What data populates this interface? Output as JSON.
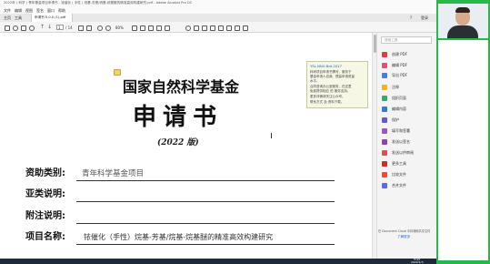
{
  "window": {
    "title": "2022年 ( 科学 ) 青年基金项目申请书 - 铱催化 ( 手性 ) 烷基-芳基/烷基-烷基醚的精准高效构建研究.pdf - Adobe Acrobat Pro DC",
    "menu": [
      "文件",
      "编辑",
      "视图",
      "签名",
      "窗口",
      "帮助"
    ],
    "tab_left": "主页",
    "tab_right": "工具",
    "doc_tab": "申请书 5.0.0 (1).pdf",
    "right_actions": [
      "?",
      "登录"
    ]
  },
  "toolbar": {
    "page_current": "1",
    "page_total": "/ 14",
    "zoom": "80%"
  },
  "document": {
    "title_main": "国家自然科学基金",
    "title_doc": "申 请 书",
    "year": "(2022 版)",
    "fields": [
      {
        "label": "资助类别:",
        "value": "青年科学基金项目"
      },
      {
        "label": "亚类说明:",
        "value": ""
      },
      {
        "label": "附注说明:",
        "value": ""
      },
      {
        "label": "项目名称:",
        "value": "铱催化（手性）烷基-芳基/烷基-烷基醚的精准高效构建研究"
      }
    ]
  },
  "popup": {
    "header": "YSL.NNU.Bot.2017",
    "lines": [
      "科研项目申请书撰写，服务于",
      "基金申请人自我、提高申请质量",
      "水平。",
      "合同咨询办公室服务，在这里",
      "免费提供相应 的 服务支持。",
      "更多详情请关注公众号。",
      "联系方式 及 资料下载。"
    ]
  },
  "right_panel": {
    "search_placeholder": "搜索工具",
    "items": [
      {
        "label": "创建 PDF",
        "icon": "create-pdf-icon",
        "color": "#d64141"
      },
      {
        "label": "编辑 PDF",
        "icon": "edit-pdf-icon",
        "color": "#e0527a"
      },
      {
        "label": "导出 PDF",
        "icon": "export-pdf-icon",
        "color": "#4a7fd4"
      },
      {
        "label": "注释",
        "icon": "comment-icon",
        "color": "#f0b429"
      },
      {
        "label": "组织页面",
        "icon": "organize-pages-icon",
        "color": "#3aa66a"
      },
      {
        "label": "编辑内容",
        "icon": "edit-content-icon",
        "color": "#2f80c8"
      },
      {
        "label": "保护",
        "icon": "protect-icon",
        "color": "#6a5acd"
      },
      {
        "label": "填写和签署",
        "icon": "fill-sign-icon",
        "color": "#9b59b6"
      },
      {
        "label": "发送以签名",
        "icon": "send-sign-icon",
        "color": "#8e44ad"
      },
      {
        "label": "发送以供审阅",
        "icon": "send-review-icon",
        "color": "#d9534f"
      },
      {
        "label": "更多工具",
        "icon": "more-tools-icon",
        "color": "#c9302c"
      },
      {
        "label": "比较文件",
        "icon": "compare-files-icon",
        "color": "#e74c3c"
      },
      {
        "label": "合并文件",
        "icon": "combine-files-icon",
        "color": "#5b6ee1"
      }
    ],
    "footer_line1": "在 Document Cloud 中存储和共享文件",
    "footer_line2": "了解更多"
  },
  "taskbar": {
    "time": "9:49",
    "date": "2022/1/3"
  },
  "colors": {
    "accent_green": "#27b84a",
    "panel_bg": "#f4f4f4",
    "popup_bg": "#f7f7e6"
  }
}
